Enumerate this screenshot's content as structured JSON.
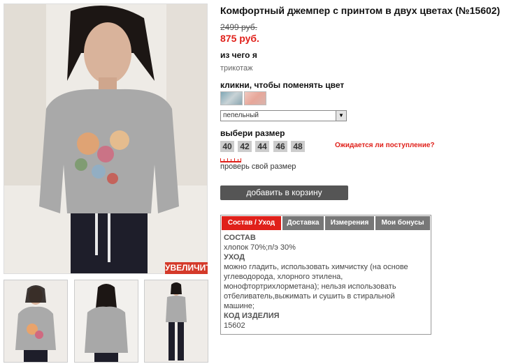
{
  "product": {
    "title": "Комфортный джемпер с принтом в двух цветах (№15602)",
    "old_price": "2499 руб.",
    "new_price": "875 руб."
  },
  "gallery": {
    "zoom_label": "УВЕЛИЧИТЬ"
  },
  "material": {
    "label": "из чего я",
    "value": "трикотаж"
  },
  "color": {
    "label": "кликни, чтобы поменять цвет",
    "selected": "пепельный"
  },
  "size": {
    "label": "выбери размер",
    "options": [
      "40",
      "42",
      "44",
      "46",
      "48"
    ],
    "await_link": "Ожидается ли поступление?",
    "check_link": "проверь свой размер"
  },
  "cart": {
    "button_label": "добавить в корзину"
  },
  "tabs": {
    "items": [
      "Состав / Уход",
      "Доставка",
      "Измерения",
      "Мои бонусы"
    ],
    "active": 0,
    "content": {
      "composition_h": "СОСТАВ",
      "composition": "хлопок 70%;п/э 30%",
      "care_h": "УХОД",
      "care": "можно гладить, использовать химчистку (на основе углеводорода, хлорного этилена, монофтортрихлорметана); нельзя использовать отбеливатель,выжимать и сушить в стиральной машине;",
      "code_h": "КОД ИЗДЕЛИЯ",
      "code": "15602"
    }
  },
  "colors": {
    "accent": "#e0201a",
    "button": "#555555",
    "tab_inactive": "#777777"
  }
}
